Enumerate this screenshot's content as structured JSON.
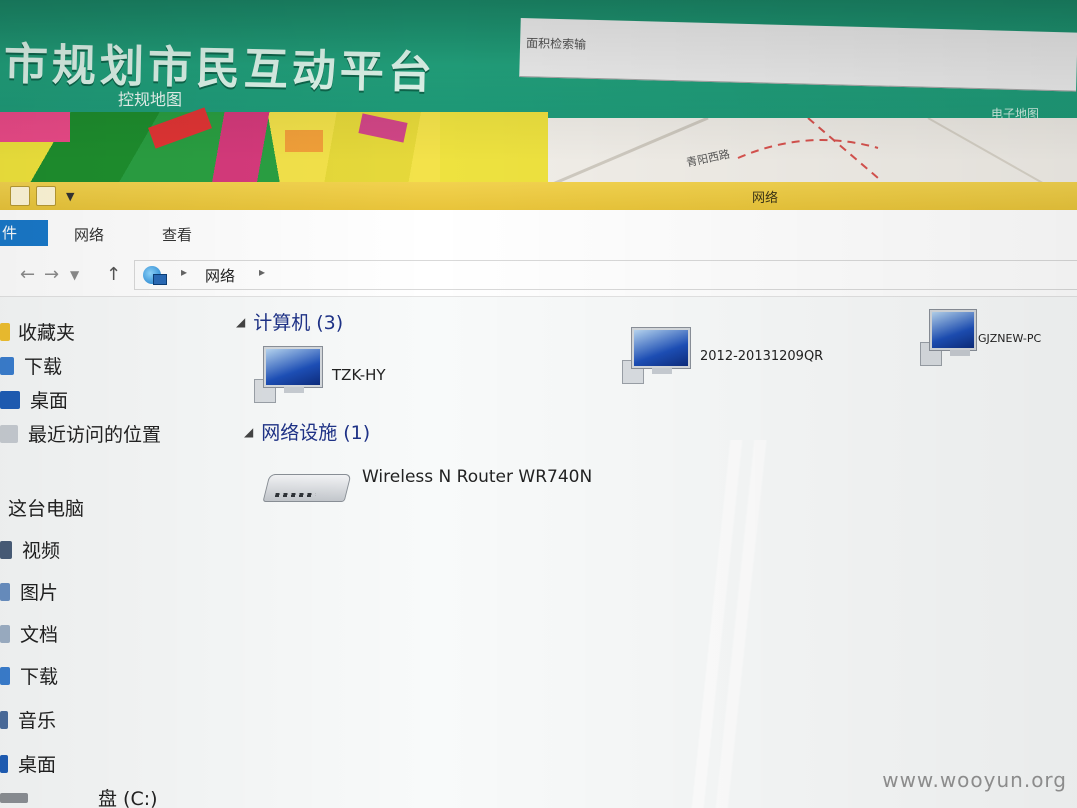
{
  "background_page": {
    "title": "市规划市民互动平台",
    "nav_item": "控规地图",
    "nav_right": "电子地图",
    "search_hint": "面积检索输",
    "road_label": "青阳西路"
  },
  "window": {
    "title": "网络"
  },
  "ribbon": {
    "file_tab": "件",
    "tabs": [
      "网络",
      "查看"
    ]
  },
  "address_bar": {
    "location": "网络"
  },
  "nav_pane": {
    "favorites": "收藏夹",
    "favorites_items": [
      "下载",
      "桌面",
      "最近访问的位置"
    ],
    "this_pc": "这台电脑",
    "this_pc_items": [
      "视频",
      "图片",
      "文档",
      "下载",
      "音乐",
      "桌面"
    ],
    "drive": "盘 (C:)"
  },
  "content": {
    "computers_header": "计算机 (3)",
    "computers": [
      "TZK-HY",
      "2012-20131209QR",
      "GJZNEW-PC"
    ],
    "infrastructure_header": "网络设施 (1)",
    "devices": [
      "Wireless N Router WR740N"
    ]
  },
  "watermark": "www.wooyun.org"
}
